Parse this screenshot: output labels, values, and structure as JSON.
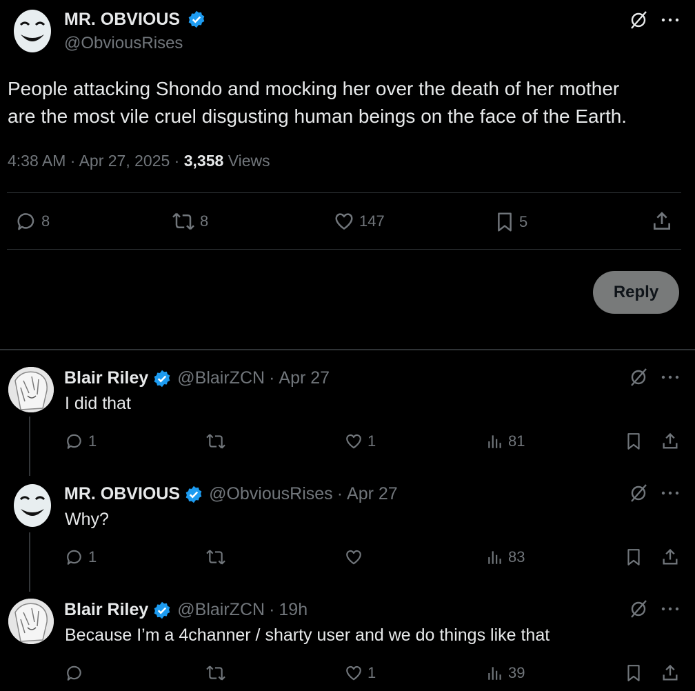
{
  "main_post": {
    "display_name": "MR. OBVIOUS",
    "handle": "@ObviousRises",
    "text_line1": "People attacking Shondo and mocking her over the death of her mother",
    "text_line2": "are the most vile cruel disgusting human beings on the face of the Earth.",
    "time": "4:38 AM",
    "date": "Apr 27, 2025",
    "views_count": "3,358",
    "views_label": "Views",
    "replies": "8",
    "reposts": "8",
    "likes": "147",
    "bookmarks": "5",
    "reply_button": "Reply",
    "verified_color": "#1d9bf0"
  },
  "replies": [
    {
      "display_name": "Blair Riley",
      "handle": "@BlairZCN",
      "sep": "·",
      "date": "Apr 27",
      "text": "I did that",
      "replies": "1",
      "reposts": "",
      "likes": "1",
      "views": "81"
    },
    {
      "display_name": "MR. OBVIOUS",
      "handle": "@ObviousRises",
      "sep": "·",
      "date": "Apr 27",
      "text": "Why?",
      "replies": "1",
      "reposts": "",
      "likes": "",
      "views": "83"
    },
    {
      "display_name": "Blair Riley",
      "handle": "@BlairZCN",
      "sep": "·",
      "date": "19h",
      "text": "Because I’m a 4channer / sharty user and we do things like that",
      "replies": "",
      "reposts": "",
      "likes": "1",
      "views": "39"
    }
  ],
  "icons": {
    "grok": "grok-icon",
    "more": "more-icon",
    "reply": "reply-icon",
    "repost": "repost-icon",
    "like": "like-icon",
    "bookmark": "bookmark-icon",
    "share": "share-icon",
    "views": "views-icon",
    "verified": "verified-badge-icon"
  }
}
